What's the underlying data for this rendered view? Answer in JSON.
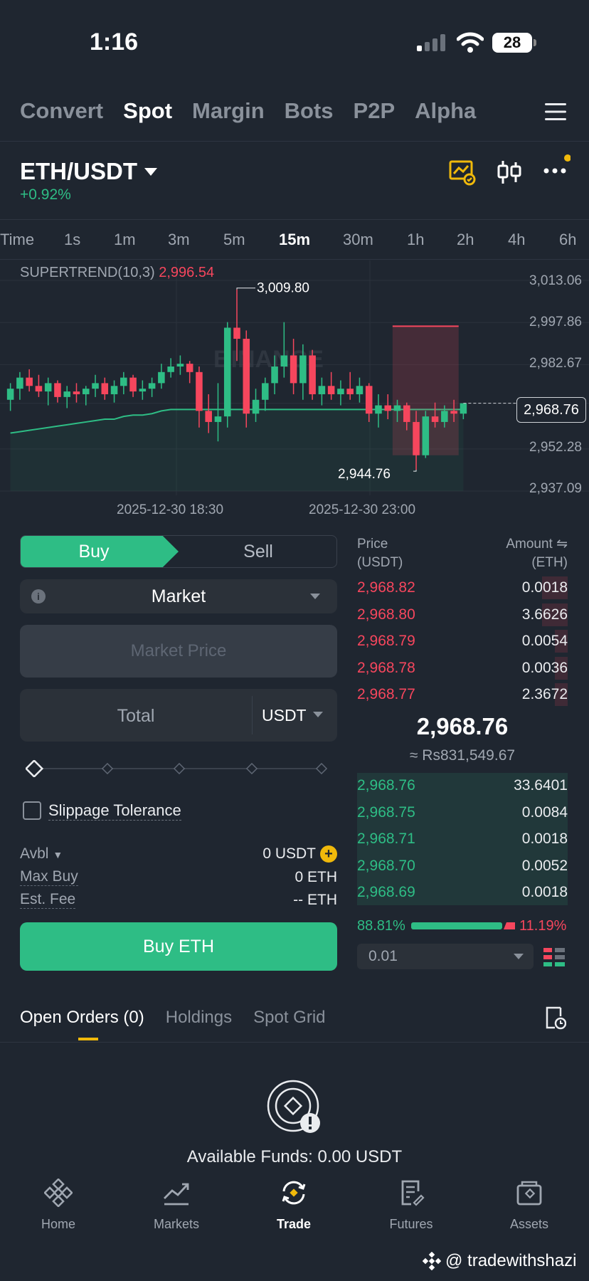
{
  "status": {
    "time": "1:16",
    "battery": "28"
  },
  "top_tabs": [
    {
      "label": "Convert",
      "active": false
    },
    {
      "label": "Spot",
      "active": true
    },
    {
      "label": "Margin",
      "active": false
    },
    {
      "label": "Bots",
      "active": false
    },
    {
      "label": "P2P",
      "active": false
    },
    {
      "label": "Alpha",
      "active": false
    }
  ],
  "pair": {
    "symbol": "ETH/USDT",
    "change": "+0.92%"
  },
  "intervals": [
    {
      "label": "Time"
    },
    {
      "label": "1s"
    },
    {
      "label": "1m"
    },
    {
      "label": "3m"
    },
    {
      "label": "5m"
    },
    {
      "label": "15m",
      "active": true
    },
    {
      "label": "30m"
    },
    {
      "label": "1h"
    },
    {
      "label": "2h"
    },
    {
      "label": "4h"
    },
    {
      "label": "6h"
    }
  ],
  "chart": {
    "indicator_label": "SUPERTREND(10,3)",
    "indicator_value": "2,996.54",
    "high_label": "3,009.80",
    "low_label": "2,944.76",
    "current_price": "2,968.76",
    "price_axis": [
      "3,013.06",
      "2,997.86",
      "2,982.67",
      "2,968.76",
      "2,952.28",
      "2,937.09"
    ],
    "dates": [
      "2025-12-30 18:30",
      "2025-12-30 23:00"
    ],
    "watermark": "BINANCE"
  },
  "chart_data": {
    "type": "candlestick",
    "ylim": [
      2937.09,
      3013.06
    ],
    "y_ticks": [
      3013.06,
      2997.86,
      2982.67,
      2968.76,
      2952.28,
      2937.09
    ],
    "x_ticks": [
      "2025-12-30 18:30",
      "2025-12-30 23:00"
    ],
    "grid": true,
    "candles": [
      [
        2970,
        2976,
        2966,
        2974
      ],
      [
        2974,
        2980,
        2970,
        2978
      ],
      [
        2978,
        2981,
        2973,
        2975
      ],
      [
        2975,
        2979,
        2971,
        2973
      ],
      [
        2973,
        2978,
        2968,
        2976
      ],
      [
        2976,
        2977,
        2969,
        2971
      ],
      [
        2971,
        2975,
        2967,
        2973
      ],
      [
        2973,
        2976,
        2969,
        2972
      ],
      [
        2972,
        2975,
        2968,
        2974
      ],
      [
        2974,
        2979,
        2971,
        2976
      ],
      [
        2976,
        2978,
        2970,
        2972
      ],
      [
        2972,
        2977,
        2969,
        2975
      ],
      [
        2975,
        2980,
        2972,
        2978
      ],
      [
        2978,
        2979,
        2971,
        2973
      ],
      [
        2973,
        2977,
        2970,
        2974
      ],
      [
        2974,
        2978,
        2971,
        2976
      ],
      [
        2976,
        2983,
        2974,
        2980
      ],
      [
        2980,
        2985,
        2978,
        2982
      ],
      [
        2982,
        2986,
        2979,
        2983
      ],
      [
        2983,
        2984,
        2976,
        2980
      ],
      [
        2980,
        2982,
        2960,
        2966
      ],
      [
        2966,
        2972,
        2958,
        2962
      ],
      [
        2962,
        2976,
        2955,
        2964
      ],
      [
        2964,
        2998,
        2960,
        2996
      ],
      [
        2996,
        3009.8,
        2984,
        2992
      ],
      [
        2992,
        2995,
        2960,
        2965
      ],
      [
        2965,
        2974,
        2962,
        2970
      ],
      [
        2970,
        2978,
        2966,
        2976
      ],
      [
        2976,
        2986,
        2972,
        2982
      ],
      [
        2982,
        2998,
        2978,
        2986
      ],
      [
        2986,
        2992,
        2972,
        2976
      ],
      [
        2976,
        2990,
        2970,
        2986
      ],
      [
        2986,
        2988,
        2970,
        2972
      ],
      [
        2972,
        2978,
        2968,
        2975
      ],
      [
        2975,
        2980,
        2970,
        2972
      ],
      [
        2972,
        2977,
        2968,
        2974
      ],
      [
        2974,
        2980,
        2970,
        2972
      ],
      [
        2972,
        2978,
        2969,
        2975
      ],
      [
        2975,
        2976,
        2962,
        2965
      ],
      [
        2965,
        2972,
        2960,
        2968
      ],
      [
        2968,
        2972,
        2963,
        2966
      ],
      [
        2966,
        2970,
        2962,
        2968
      ],
      [
        2968,
        2969,
        2959,
        2962
      ],
      [
        2962,
        2966,
        2944.76,
        2950
      ],
      [
        2950,
        2966,
        2949,
        2964
      ],
      [
        2964,
        2969,
        2960,
        2962
      ],
      [
        2962,
        2968,
        2960,
        2966
      ],
      [
        2966,
        2970,
        2962,
        2965
      ],
      [
        2965,
        2967,
        2963,
        2968.76
      ]
    ],
    "supertrend_value": 2996.54,
    "high": 3009.8,
    "low": 2944.76,
    "last": 2968.76
  },
  "order_form": {
    "buy_label": "Buy",
    "sell_label": "Sell",
    "order_type": "Market",
    "price_placeholder": "Market Price",
    "total_placeholder": "Total",
    "total_unit": "USDT",
    "slippage_label": "Slippage Tolerance",
    "avbl_label": "Avbl",
    "avbl_value": "0 USDT",
    "max_buy_label": "Max Buy",
    "max_buy_value": "0 ETH",
    "fee_label": "Est. Fee",
    "fee_value": "-- ETH",
    "submit_label": "Buy ETH"
  },
  "order_book": {
    "price_header": "Price",
    "price_unit": "(USDT)",
    "amount_header": "Amount ⇋",
    "amount_unit": "(ETH)",
    "asks": [
      {
        "price": "2,968.82",
        "amount": "0.0018",
        "depth": 0.12
      },
      {
        "price": "2,968.80",
        "amount": "3.6626",
        "depth": 0.12
      },
      {
        "price": "2,968.79",
        "amount": "0.0054",
        "depth": 0.06
      },
      {
        "price": "2,968.78",
        "amount": "0.0036",
        "depth": 0.06
      },
      {
        "price": "2,968.77",
        "amount": "2.3672",
        "depth": 0.06
      }
    ],
    "last_price": "2,968.76",
    "last_fiat": "≈ Rs831,549.67",
    "bids": [
      {
        "price": "2,968.76",
        "amount": "33.6401"
      },
      {
        "price": "2,968.75",
        "amount": "0.0084"
      },
      {
        "price": "2,968.71",
        "amount": "0.0018"
      },
      {
        "price": "2,968.70",
        "amount": "0.0052"
      },
      {
        "price": "2,968.69",
        "amount": "0.0018"
      }
    ],
    "buy_ratio": "88.81%",
    "sell_ratio": "11.19%",
    "buy_ratio_value": 0.8881,
    "depth_step": "0.01"
  },
  "orders": {
    "tabs": [
      {
        "label": "Open Orders (0)",
        "active": true
      },
      {
        "label": "Holdings",
        "active": false
      },
      {
        "label": "Spot Grid",
        "active": false
      }
    ],
    "empty_text": "Available Funds: 0.00 USDT"
  },
  "nav": [
    {
      "label": "Home",
      "icon": "binance-logo-icon"
    },
    {
      "label": "Markets",
      "icon": "chart-line-icon"
    },
    {
      "label": "Trade",
      "icon": "trade-swap-icon",
      "active": true
    },
    {
      "label": "Futures",
      "icon": "futures-doc-icon"
    },
    {
      "label": "Assets",
      "icon": "wallet-icon"
    }
  ],
  "watermark_text": "@ tradewithshazi",
  "colors": {
    "up": "#2ebd85",
    "down": "#f6465d",
    "accent": "#f0b90b",
    "bg": "#1f2630"
  }
}
